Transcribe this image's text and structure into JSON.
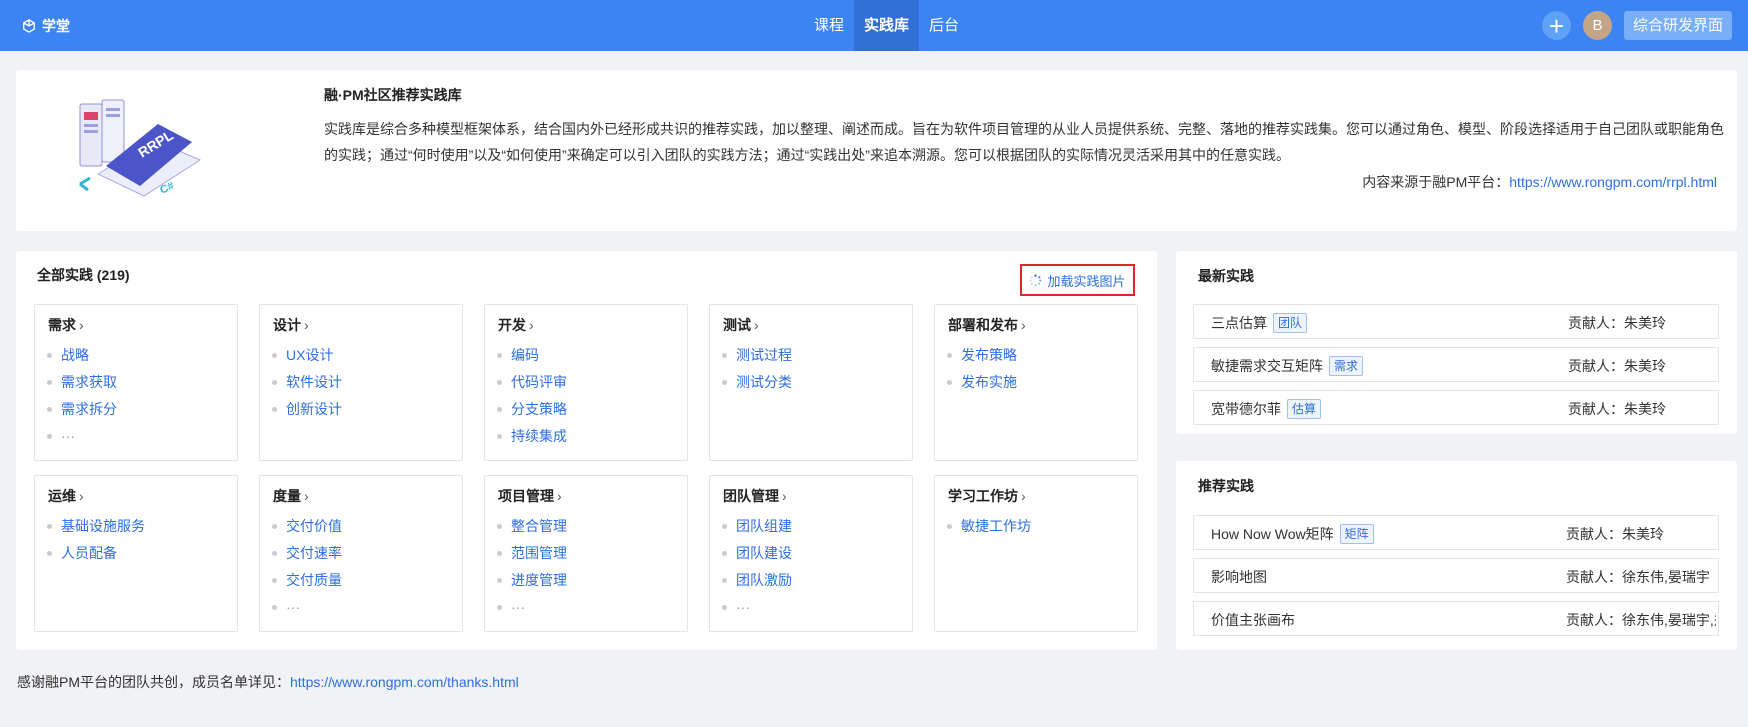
{
  "header": {
    "brand": "学堂",
    "nav": [
      "课程",
      "实践库",
      "后台"
    ],
    "active_nav": "实践库",
    "avatar_letter": "B",
    "admin_button": "综合研发界面"
  },
  "intro": {
    "title": "融·PM社区推荐实践库",
    "description": "实践库是综合多种模型框架体系，结合国内外已经形成共识的推荐实践，加以整理、阐述而成。旨在为软件项目管理的从业人员提供系统、完整、落地的推荐实践集。您可以通过角色、模型、阶段选择适用于自己团队或职能角色的实践；通过“何时使用”以及“如何使用”来确定可以引入团队的实践方法；通过“实践出处”来追本溯源。您可以根据团队的实际情况灵活采用其中的任意实践。",
    "source_label": "内容来源于融PM平台：",
    "source_url": "https://www.rongpm.com/rrpl.html",
    "illustration_text": [
      "RRPL",
      "C#"
    ]
  },
  "practices": {
    "title": "全部实践 (219)",
    "load_button": "加载实践图片",
    "categories": [
      {
        "name": "需求",
        "items": [
          "战略",
          "需求获取",
          "需求拆分"
        ],
        "more": "···"
      },
      {
        "name": "设计",
        "items": [
          "UX设计",
          "软件设计",
          "创新设计"
        ],
        "more": ""
      },
      {
        "name": "开发",
        "items": [
          "编码",
          "代码评审",
          "分支策略",
          "持续集成"
        ],
        "more": ""
      },
      {
        "name": "测试",
        "items": [
          "测试过程",
          "测试分类"
        ],
        "more": ""
      },
      {
        "name": "部署和发布",
        "items": [
          "发布策略",
          "发布实施"
        ],
        "more": ""
      },
      {
        "name": "运维",
        "items": [
          "基础设施服务",
          "人员配备"
        ],
        "more": ""
      },
      {
        "name": "度量",
        "items": [
          "交付价值",
          "交付速率",
          "交付质量"
        ],
        "more": "···"
      },
      {
        "name": "项目管理",
        "items": [
          "整合管理",
          "范围管理",
          "进度管理"
        ],
        "more": "···"
      },
      {
        "name": "团队管理",
        "items": [
          "团队组建",
          "团队建设",
          "团队激励"
        ],
        "more": "···"
      },
      {
        "name": "学习工作坊",
        "items": [
          "敏捷工作坊"
        ],
        "more": ""
      }
    ]
  },
  "latest": {
    "title": "最新实践",
    "rows": [
      {
        "name": "三点估算",
        "tag": "团队",
        "contributor": "贡献人：朱美玲"
      },
      {
        "name": "敏捷需求交互矩阵",
        "tag": "需求",
        "contributor": "贡献人：朱美玲"
      },
      {
        "name": "宽带德尔菲",
        "tag": "估算",
        "contributor": "贡献人：朱美玲"
      }
    ]
  },
  "recommend": {
    "title": "推荐实践",
    "rows": [
      {
        "name": "How Now Wow矩阵",
        "tag": "矩阵",
        "contributor": "贡献人：朱美玲"
      },
      {
        "name": "影响地图",
        "tag": "",
        "contributor": "贡献人：徐东伟,晏瑞宇"
      },
      {
        "name": "价值主张画布",
        "tag": "",
        "contributor": "贡献人：徐东伟,晏瑞宇,郑"
      }
    ]
  },
  "footer": {
    "text": "感谢融PM平台的团队共创，成员名单详见：",
    "url": "https://www.rongpm.com/thanks.html"
  },
  "colors": {
    "header_bg": "#3c84f4",
    "link": "#2f6fe0",
    "highlight_border": "#e0262b"
  }
}
